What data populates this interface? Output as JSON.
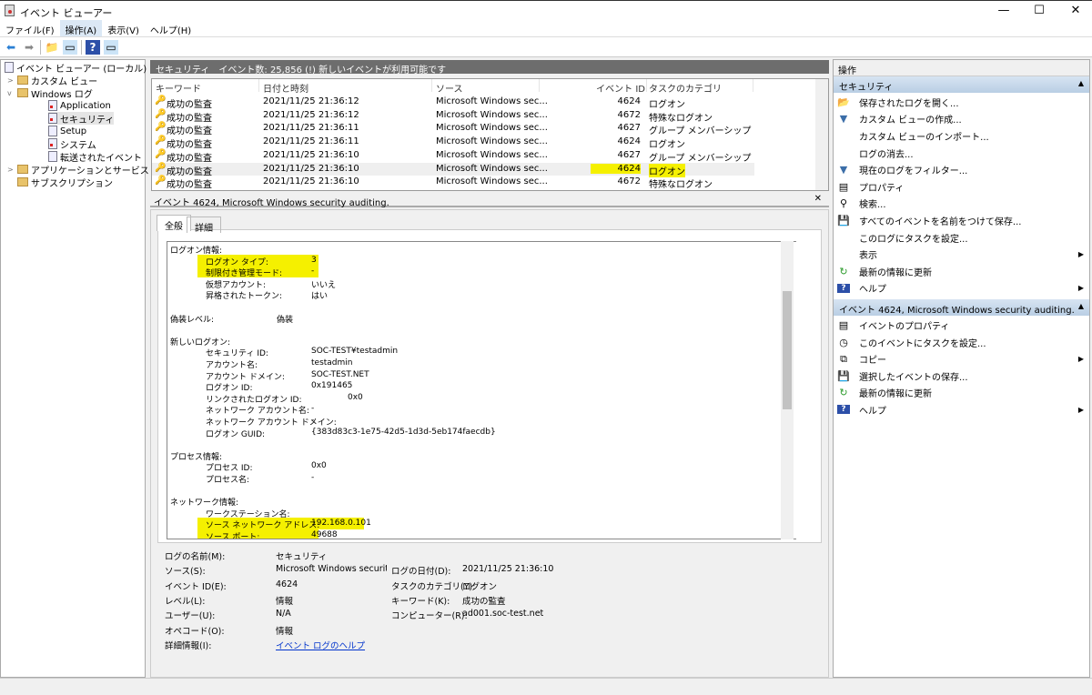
{
  "window": {
    "title": "イベント ビューアー",
    "minimize": "—",
    "maximize": "☐",
    "close": "✕"
  },
  "menu": [
    "ファイル(F)",
    "操作(A)",
    "表示(V)",
    "ヘルプ(H)"
  ],
  "toolbar": [
    {
      "icon": "back-icon",
      "glyph": "⬅"
    },
    {
      "icon": "forward-icon",
      "glyph": "➡"
    },
    {
      "icon": "up-folder-icon",
      "glyph": "📁"
    },
    {
      "icon": "show-tree-icon",
      "glyph": "▭"
    },
    {
      "icon": "help-icon",
      "glyph": "?"
    },
    {
      "icon": "show-action-pane-icon",
      "glyph": "▭"
    }
  ],
  "tree": [
    {
      "label": "イベント ビューアー (ローカル)",
      "level": 0,
      "type": "log",
      "exp": ""
    },
    {
      "label": "カスタム ビュー",
      "level": 1,
      "type": "folder",
      "exp": ">"
    },
    {
      "label": "Windows ログ",
      "level": 1,
      "type": "folder",
      "exp": "v"
    },
    {
      "label": "Application",
      "level": 2,
      "type": "logr",
      "exp": ""
    },
    {
      "label": "セキュリティ",
      "level": 2,
      "type": "logr",
      "exp": "",
      "selected": true
    },
    {
      "label": "Setup",
      "level": 2,
      "type": "log",
      "exp": ""
    },
    {
      "label": "システム",
      "level": 2,
      "type": "logr",
      "exp": ""
    },
    {
      "label": "転送されたイベント",
      "level": 2,
      "type": "log",
      "exp": ""
    },
    {
      "label": "アプリケーションとサービス ログ",
      "level": 1,
      "type": "folder",
      "exp": ">"
    },
    {
      "label": "サブスクリプション",
      "level": 1,
      "type": "folder",
      "exp": ""
    }
  ],
  "log_header": "セキュリティ　イベント数: 25,856 (!) 新しいイベントが利用可能です",
  "list": {
    "columns": [
      "キーワード",
      "日付と時刻",
      "ソース",
      "イベント ID",
      "タスクのカテゴリ"
    ],
    "rows": [
      [
        "成功の監査",
        "2021/11/25 21:36:12",
        "Microsoft Windows sec...",
        "4624",
        "ログオン"
      ],
      [
        "成功の監査",
        "2021/11/25 21:36:12",
        "Microsoft Windows sec...",
        "4672",
        "特殊なログオン"
      ],
      [
        "成功の監査",
        "2021/11/25 21:36:11",
        "Microsoft Windows sec...",
        "4627",
        "グループ メンバーシップ"
      ],
      [
        "成功の監査",
        "2021/11/25 21:36:11",
        "Microsoft Windows sec...",
        "4624",
        "ログオン"
      ],
      [
        "成功の監査",
        "2021/11/25 21:36:10",
        "Microsoft Windows sec...",
        "4627",
        "グループ メンバーシップ"
      ],
      [
        "成功の監査",
        "2021/11/25 21:36:10",
        "Microsoft Windows sec...",
        "4624",
        "ログオン"
      ],
      [
        "成功の監査",
        "2021/11/25 21:36:10",
        "Microsoft Windows sec...",
        "4672",
        "特殊なログオン"
      ]
    ],
    "selected_row": 5
  },
  "detail": {
    "title": "イベント 4624, Microsoft Windows security auditing.",
    "close": "✕",
    "tabs": [
      "全般",
      "詳細"
    ],
    "lines": [
      {
        "t": "ログオン情報:",
        "ind": 0
      },
      {
        "t": "ログオン タイプ:",
        "v": "3",
        "ind": 1,
        "hl": true
      },
      {
        "t": "制限付き管理モード:",
        "v": "-",
        "ind": 1,
        "hl": true
      },
      {
        "t": "仮想アカウント:",
        "v": "いいえ",
        "ind": 1
      },
      {
        "t": "昇格されたトークン:",
        "v": "はい",
        "ind": 1
      },
      {
        "t": "",
        "ind": 0
      },
      {
        "t": "偽装レベル:",
        "v": "偽装",
        "ind": 0,
        "vx": 1
      },
      {
        "t": "",
        "ind": 0
      },
      {
        "t": "新しいログオン:",
        "ind": 0
      },
      {
        "t": "セキュリティ ID:",
        "v": "SOC-TEST¥testadmin",
        "ind": 1
      },
      {
        "t": "アカウント名:",
        "v": "testadmin",
        "ind": 1
      },
      {
        "t": "アカウント ドメイン:",
        "v": "SOC-TEST.NET",
        "ind": 1
      },
      {
        "t": "ログオン ID:",
        "v": "0x191465",
        "ind": 1
      },
      {
        "t": "リンクされたログオン ID:",
        "v": "0x0",
        "ind": 1,
        "vx": 2
      },
      {
        "t": "ネットワーク アカウント名:",
        "v": "-",
        "ind": 1
      },
      {
        "t": "ネットワーク アカウント ドメイン:",
        "v": "-",
        "ind": 1
      },
      {
        "t": "ログオン GUID:",
        "v": "{383d83c3-1e75-42d5-1d3d-5eb174faecdb}",
        "ind": 1
      },
      {
        "t": "",
        "ind": 0
      },
      {
        "t": "プロセス情報:",
        "ind": 0
      },
      {
        "t": "プロセス ID:",
        "v": "0x0",
        "ind": 1
      },
      {
        "t": "プロセス名:",
        "v": "-",
        "ind": 1
      },
      {
        "t": "",
        "ind": 0
      },
      {
        "t": "ネットワーク情報:",
        "ind": 0
      },
      {
        "t": "ワークステーション名:",
        "v": "",
        "ind": 1
      },
      {
        "t": "ソース ネットワーク アドレス:",
        "v": "192.168.0.101",
        "ind": 1,
        "hl": true
      },
      {
        "t": "ソース ポート:",
        "v": "49688",
        "ind": 1,
        "hl": true
      }
    ],
    "fields_left": [
      [
        "ログの名前(M):",
        "セキュリティ"
      ],
      [
        "ソース(S):",
        "Microsoft Windows security a"
      ],
      [
        "イベント ID(E):",
        "4624"
      ],
      [
        "レベル(L):",
        "情報"
      ],
      [
        "ユーザー(U):",
        "N/A"
      ],
      [
        "オペコード(O):",
        "情報"
      ],
      [
        "詳細情報(I):",
        "イベント ログのヘルプ"
      ]
    ],
    "fields_right": [
      [
        "ログの日付(D):",
        "2021/11/25 21:36:10"
      ],
      [
        "タスクのカテゴリ(Y):",
        "ログオン"
      ],
      [
        "キーワード(K):",
        "成功の監査"
      ],
      [
        "コンピューター(R):",
        "ad001.soc-test.net"
      ]
    ]
  },
  "actions": {
    "title": "操作",
    "sections": [
      {
        "header": "セキュリティ",
        "items": [
          {
            "label": "保存されたログを開く...",
            "icon": "open-folder-icon",
            "g": "📂"
          },
          {
            "label": "カスタム ビューの作成...",
            "icon": "filter-icon",
            "g": "▼"
          },
          {
            "label": "カスタム ビューのインポート...",
            "icon": "",
            "g": ""
          },
          {
            "label": "ログの消去...",
            "icon": "",
            "g": ""
          },
          {
            "label": "現在のログをフィルター...",
            "icon": "filter-icon",
            "g": "▼"
          },
          {
            "label": "プロパティ",
            "icon": "properties-icon",
            "g": "▤"
          },
          {
            "label": "検索...",
            "icon": "binoculars-icon",
            "g": "⚲"
          },
          {
            "label": "すべてのイベントを名前をつけて保存...",
            "icon": "save-icon",
            "g": "💾"
          },
          {
            "label": "このログにタスクを設定...",
            "icon": "",
            "g": ""
          },
          {
            "label": "表示",
            "icon": "",
            "g": "",
            "sub": true
          },
          {
            "label": "最新の情報に更新",
            "icon": "refresh-icon",
            "g": "↻"
          },
          {
            "label": "ヘルプ",
            "icon": "help-icon",
            "g": "?",
            "sub": true
          }
        ]
      },
      {
        "header": "イベント 4624, Microsoft Windows security auditing.",
        "items": [
          {
            "label": "イベントのプロパティ",
            "icon": "properties-icon",
            "g": "▤"
          },
          {
            "label": "このイベントにタスクを設定...",
            "icon": "task-icon",
            "g": "◷"
          },
          {
            "label": "コピー",
            "icon": "copy-icon",
            "g": "⧉",
            "sub": true
          },
          {
            "label": "選択したイベントの保存...",
            "icon": "save-icon",
            "g": "💾"
          },
          {
            "label": "最新の情報に更新",
            "icon": "refresh-icon",
            "g": "↻"
          },
          {
            "label": "ヘルプ",
            "icon": "help-icon",
            "g": "?",
            "sub": true
          }
        ]
      }
    ]
  },
  "colors": {
    "highlight": "#f5f000",
    "header_bar": "#6d6d6d",
    "action_header": "#c6d8ea",
    "link": "#0033cc"
  }
}
